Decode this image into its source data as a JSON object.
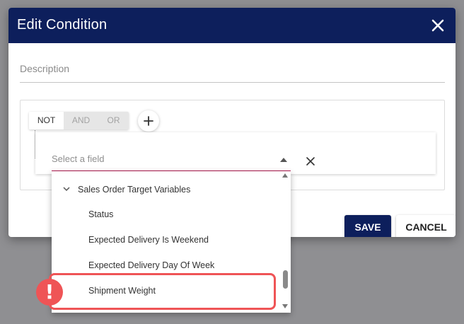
{
  "dialog": {
    "title": "Edit Condition",
    "description_placeholder": "Description",
    "logic_buttons": {
      "not": "NOT",
      "and": "AND",
      "or": "OR"
    },
    "save_label": "SAVE",
    "cancel_label": "CANCEL"
  },
  "field_select": {
    "placeholder": "Select a field"
  },
  "dropdown": {
    "group_label": "Sales Order Target Variables",
    "items": [
      {
        "label": "Status"
      },
      {
        "label": "Expected Delivery Is Weekend"
      },
      {
        "label": "Expected Delivery Day Of Week"
      },
      {
        "label": "Shipment Weight"
      }
    ]
  },
  "annotation": {
    "badge_text": "!",
    "color": "#ef5456"
  },
  "colors": {
    "header": "#0d1f5c",
    "primary_button": "#0d1f5c",
    "focus_underline": "#b0174e",
    "backdrop": "#8f8f92"
  },
  "icons": {
    "close": "close-icon",
    "add": "plus-icon",
    "select_arrow": "triangle-up-icon",
    "clear": "close-icon",
    "group_toggle": "chevron-down-icon"
  }
}
